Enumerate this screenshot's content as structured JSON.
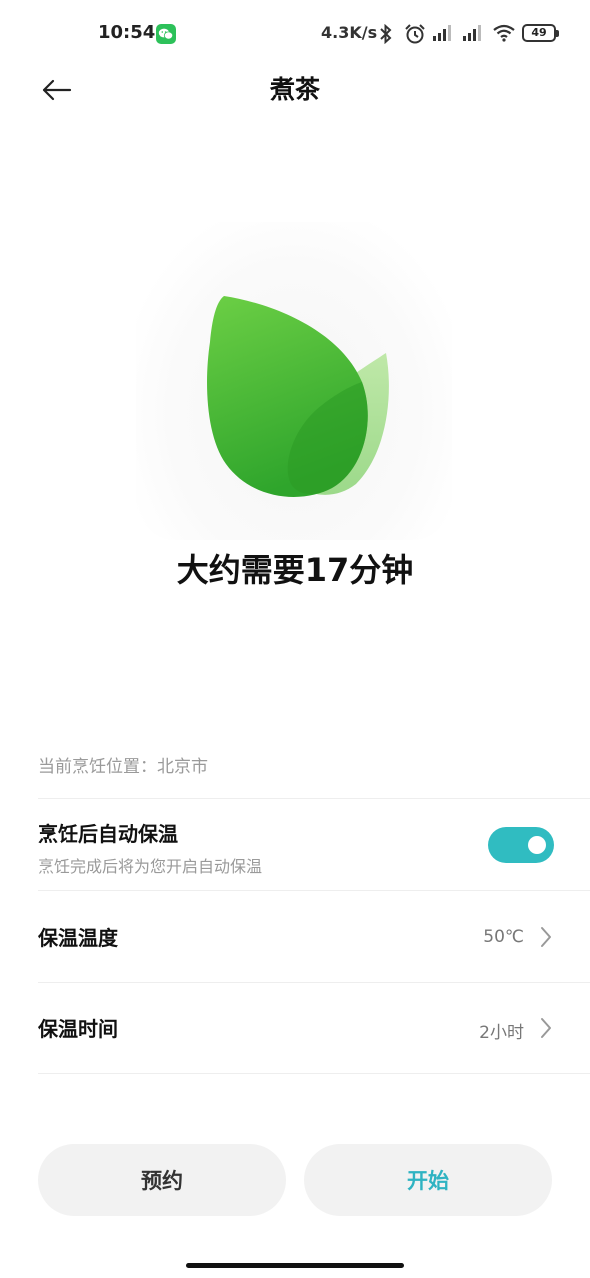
{
  "status_bar": {
    "time": "10:54",
    "network_speed": "4.3K/s",
    "battery": "49",
    "icons": [
      "wechat-icon",
      "bluetooth-icon",
      "alarm-icon",
      "signal-icon",
      "signal-icon",
      "wifi-icon",
      "battery-icon"
    ]
  },
  "header": {
    "title": "煮茶",
    "back_icon": "arrow-left-icon"
  },
  "hero": {
    "icon": "leaf-icon",
    "cook_time": "大约需要17分钟"
  },
  "settings": {
    "location": "当前烹饪位置：北京市",
    "auto_keep_warm": {
      "title": "烹饪后自动保温",
      "subtitle": "烹饪完成后将为您开启自动保温",
      "enabled": true
    },
    "keep_warm_temp": {
      "title": "保温温度",
      "value": "50℃"
    },
    "keep_warm_time": {
      "title": "保温时间",
      "value": "2小时"
    }
  },
  "actions": {
    "reserve_label": "预约",
    "start_label": "开始"
  },
  "colors": {
    "accent": "#30bcc1",
    "start_text": "#2fb3c2",
    "leaf_dark": "#3fb53a",
    "leaf_light": "#a8e08f"
  }
}
